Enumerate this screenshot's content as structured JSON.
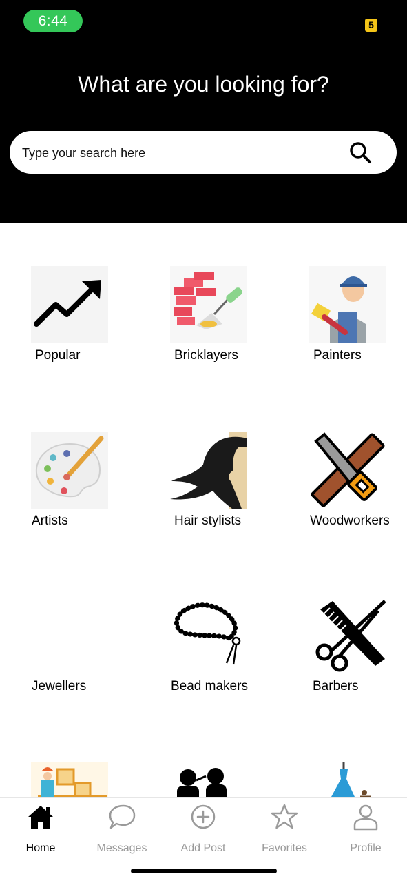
{
  "status_bar": {
    "time": "6:44",
    "badge": "5"
  },
  "header": {
    "title": "What are you looking for?"
  },
  "search": {
    "placeholder": "Type your search here",
    "value": ""
  },
  "categories": [
    {
      "label": "Popular",
      "icon": "trending-up-icon"
    },
    {
      "label": "Bricklayers",
      "icon": "bricks-trowel-icon"
    },
    {
      "label": "Painters",
      "icon": "painter-icon"
    },
    {
      "label": "Artists",
      "icon": "palette-icon"
    },
    {
      "label": "Hair stylists",
      "icon": "woman-hair-icon"
    },
    {
      "label": "Woodworkers",
      "icon": "saw-plank-icon"
    },
    {
      "label": "Jewellers",
      "icon": ""
    },
    {
      "label": "Bead makers",
      "icon": "bead-necklace-icon"
    },
    {
      "label": "Barbers",
      "icon": "comb-scissors-icon"
    }
  ],
  "bottom_nav": [
    {
      "label": "Home",
      "icon": "home-icon",
      "active": true
    },
    {
      "label": "Messages",
      "icon": "chat-bubble-icon",
      "active": false
    },
    {
      "label": "Add Post",
      "icon": "plus-circle-icon",
      "active": false
    },
    {
      "label": "Favorites",
      "icon": "star-icon",
      "active": false
    },
    {
      "label": "Profile",
      "icon": "user-icon",
      "active": false
    }
  ],
  "colors": {
    "header_bg": "#000000",
    "time_pill": "#34c759",
    "badge": "#f5c518",
    "inactive_nav": "#9a9a9a"
  }
}
